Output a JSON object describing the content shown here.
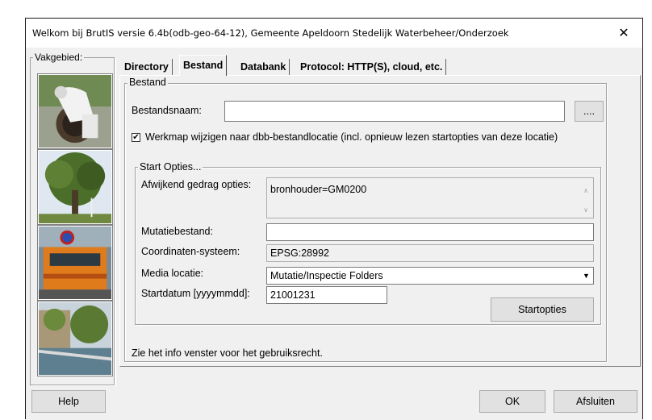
{
  "window": {
    "title": "Welkom bij BrutIS versie 6.4b(odb-geo-64-12), Gemeente Apeldoorn Stedelijk Waterbeheer/Onderzoek",
    "close_glyph": "✕"
  },
  "sidebar": {
    "label": "Vakgebied:",
    "photos": [
      "worker-manhole-photo",
      "tree-photo",
      "train-photo",
      "canal-photo"
    ]
  },
  "tabs": [
    {
      "label": "Directory",
      "active": false
    },
    {
      "label": "Bestand",
      "active": true
    },
    {
      "label": "Databank",
      "active": false
    },
    {
      "label": "Protocol: HTTP(S), cloud, etc.",
      "active": false
    }
  ],
  "bestand": {
    "group_label": "Bestand",
    "filename_label": "Bestandsnaam:",
    "filename_value": "",
    "browse_label": "....",
    "checkbox_checked": true,
    "checkbox_mark": "✔",
    "checkbox_label": "Werkmap wijzigen naar dbb-bestandlocatie (incl. opnieuw lezen startopties van deze locatie)"
  },
  "start_opties": {
    "group_label": "Start Opties...",
    "afwijkend_label": "Afwijkend gedrag opties:",
    "afwijkend_value": "bronhouder=GM0200",
    "mutatie_label": "Mutatiebestand:",
    "mutatie_value": "",
    "coord_label": "Coordinaten-systeem:",
    "coord_value": "EPSG:28992",
    "media_label": "Media locatie:",
    "media_value": "Mutatie/Inspectie Folders",
    "startdatum_label": "Startdatum [yyyymmdd]:",
    "startdatum_value": "21001231",
    "startopties_button": "Startopties"
  },
  "info_text": "Zie het info venster voor het gebruiksrecht.",
  "buttons": {
    "help": "Help",
    "ok": "OK",
    "afsluiten": "Afsluiten"
  }
}
